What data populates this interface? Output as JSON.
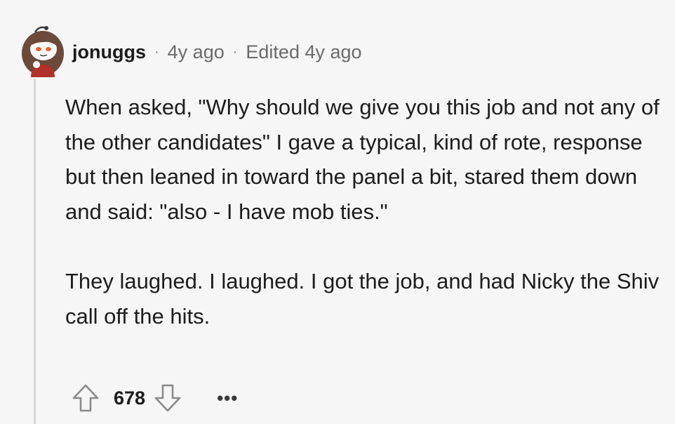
{
  "comment": {
    "username": "jonuggs",
    "separator": "·",
    "posted": "4y ago",
    "edited": "Edited 4y ago",
    "paragraphs": [
      "When asked, \"Why should we give you this job and not any of the other candidates\" I gave a typical, kind of rote, response but then leaned in toward the panel a bit, stared them down and said: \"also - I have mob ties.\"",
      "They laughed. I laughed. I got the job, and had Nicky the Shiv call off the hits."
    ],
    "score": "678",
    "more": "•••"
  },
  "colors": {
    "background": "#f6f6f6",
    "text": "#1c1c1c",
    "meta": "#6a6a6a",
    "thread_line": "#d6d6d6",
    "icon_stroke": "#8a8a8a"
  },
  "icons": {
    "avatar": "snoo-avatar-icon",
    "upvote": "arrow-up-icon",
    "downvote": "arrow-down-icon",
    "more": "more-options-icon"
  }
}
